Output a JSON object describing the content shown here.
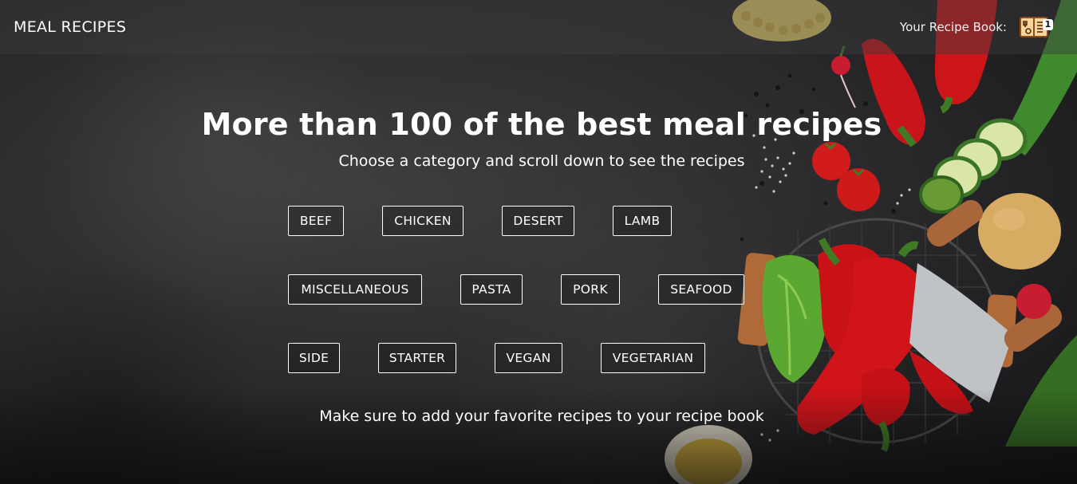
{
  "header": {
    "brand": "MEAL RECIPES",
    "recipe_book_label": "Your Recipe Book:",
    "recipe_book_count": "1"
  },
  "hero": {
    "title": "More than 100 of the best meal recipes",
    "subtitle": "Choose a category and scroll down to see the recipes",
    "categories": [
      "BEEF",
      "CHICKEN",
      "DESERT",
      "LAMB",
      "MISCELLANEOUS",
      "PASTA",
      "PORK",
      "SEAFOOD",
      "SIDE",
      "STARTER",
      "VEGAN",
      "VEGETARIAN"
    ],
    "note": "Make sure to add your favorite recipes to your recipe book"
  },
  "colors": {
    "background": "#2c2c2e",
    "header_bg": "rgba(60,60,62,0.45)",
    "text": "#ffffff",
    "pepper": "#c8141a",
    "zucchini": "#3f8a2c",
    "potato": "#d4a45a"
  },
  "icons": {
    "recipe_book": "recipe-book-icon"
  }
}
